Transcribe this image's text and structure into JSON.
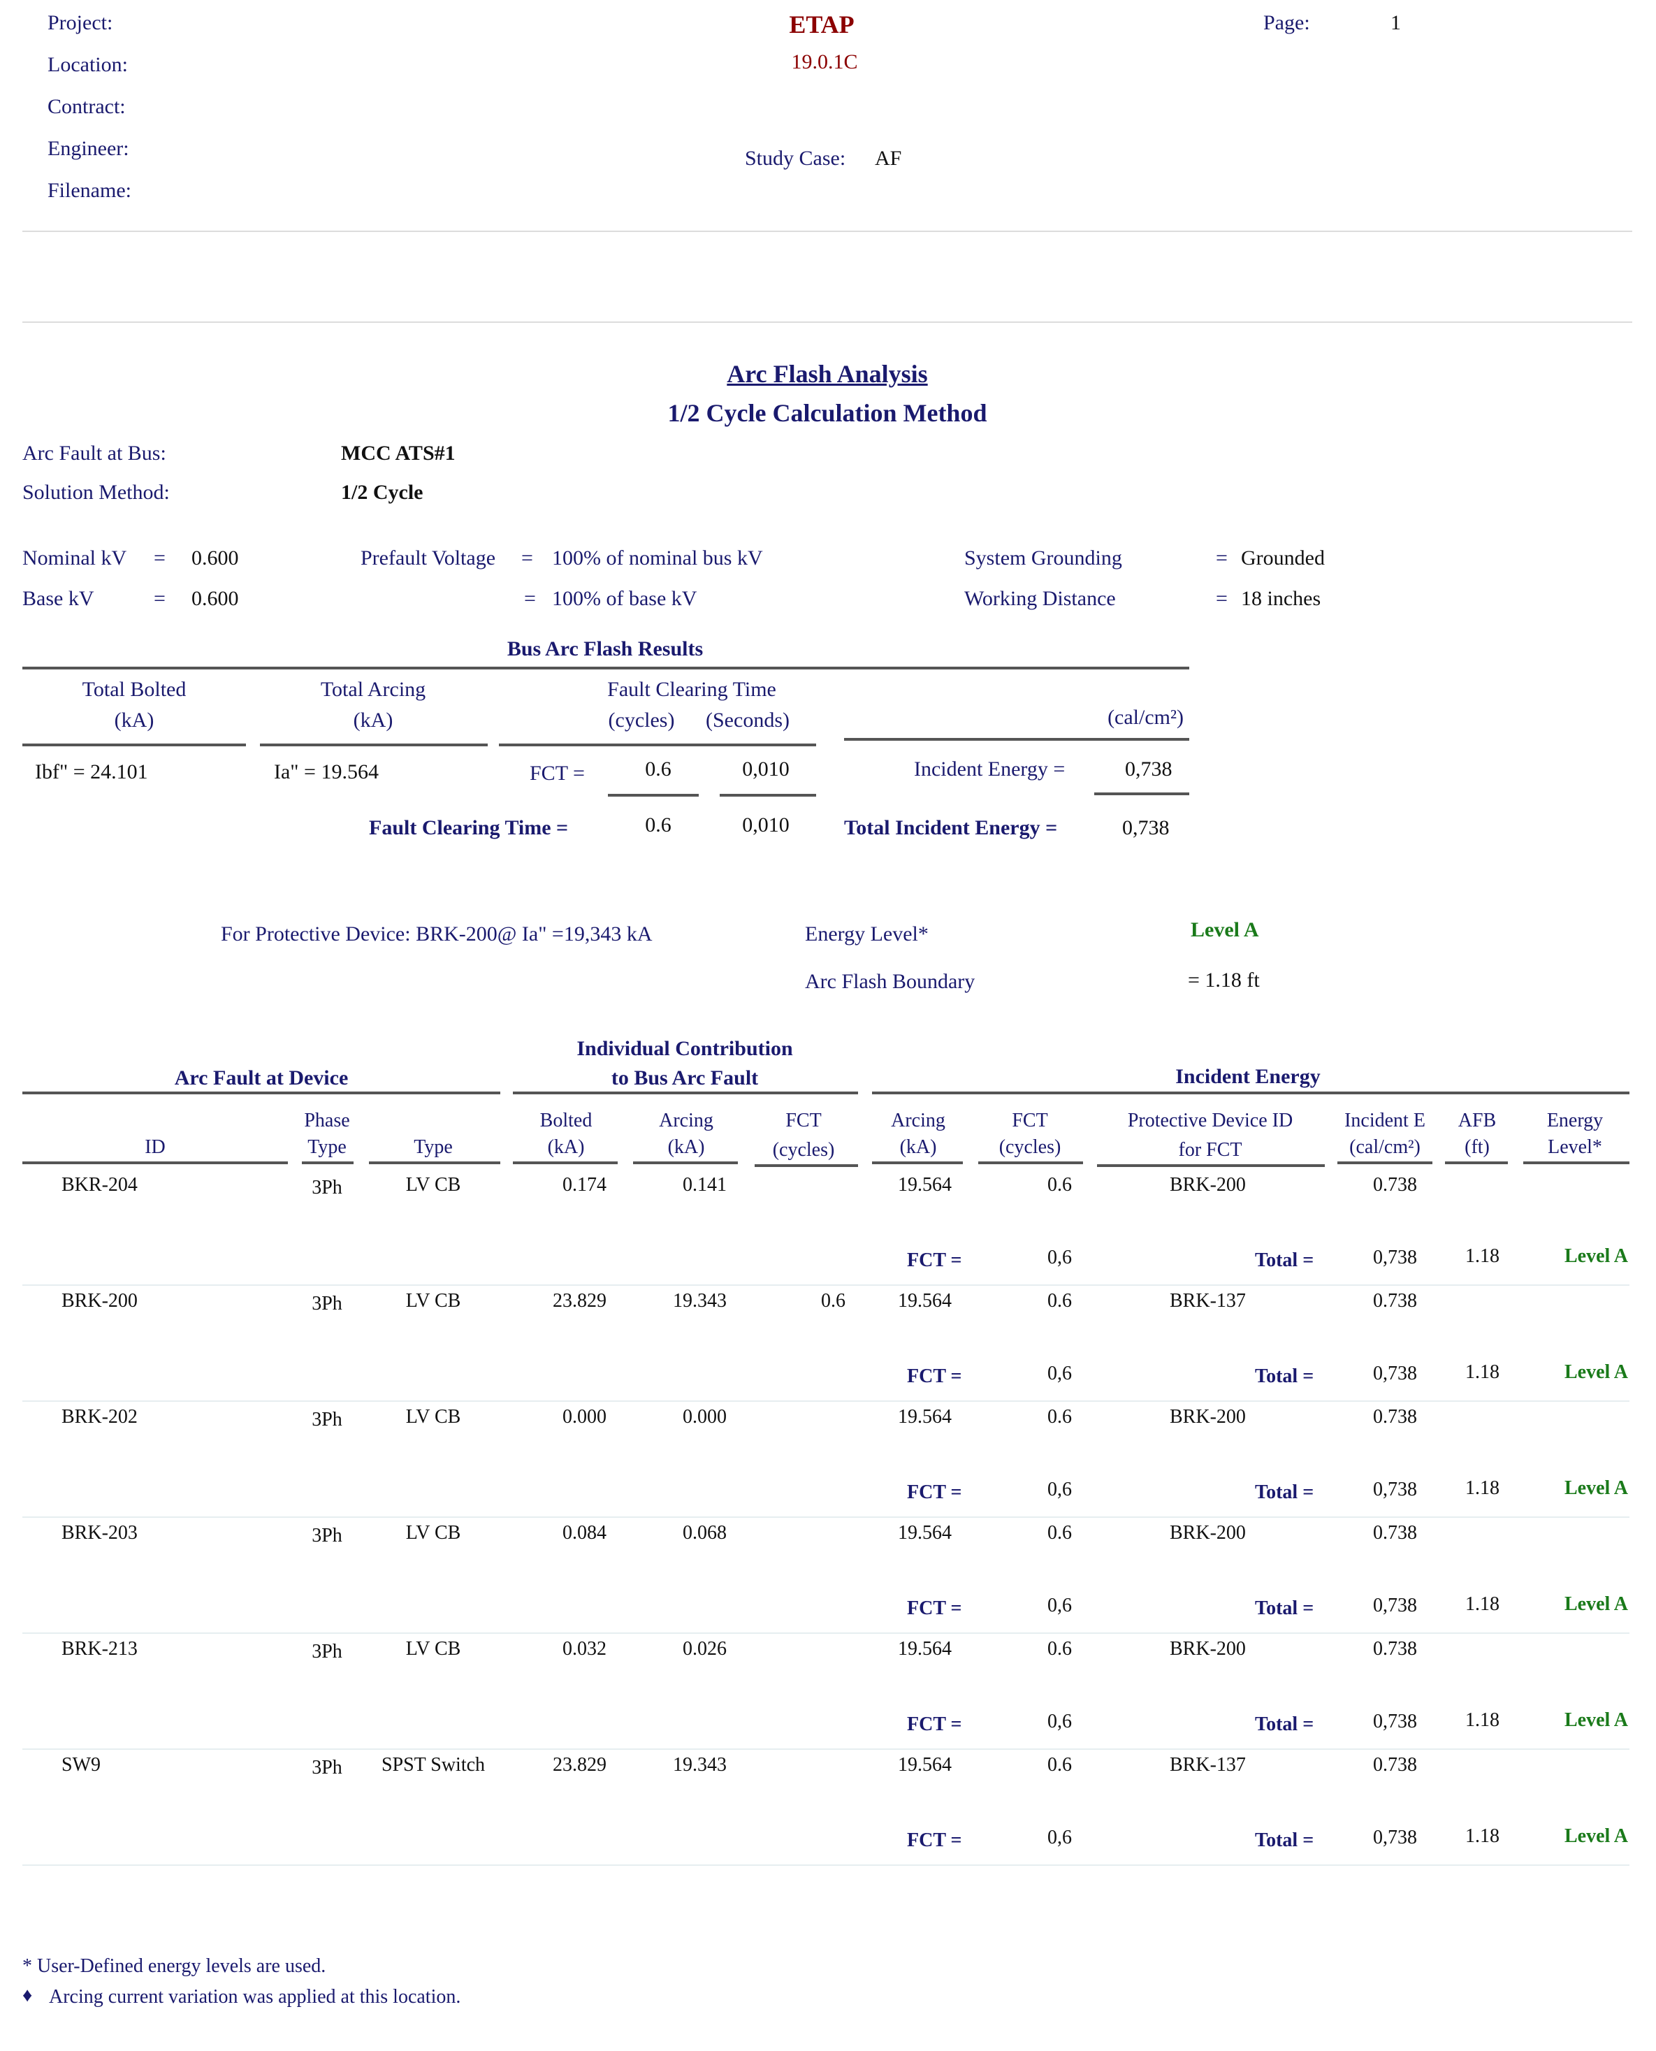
{
  "header": {
    "project_label": "Project:",
    "location_label": "Location:",
    "contract_label": "Contract:",
    "engineer_label": "Engineer:",
    "filename_label": "Filename:",
    "app_name": "ETAP",
    "version": "19.0.1C",
    "page_label": "Page:",
    "page_number": "1",
    "study_case_label": "Study Case:",
    "study_case_value": "AF"
  },
  "title": {
    "main": "Arc Flash Analysis",
    "sub": "1/2 Cycle Calculation Method"
  },
  "info": {
    "arc_fault_bus_label": "Arc Fault at Bus:",
    "arc_fault_bus_value": "MCC ATS#1",
    "solution_method_label": "Solution Method:",
    "solution_method_value": "1/2 Cycle",
    "nominal_kv_label": "Nominal kV",
    "nominal_kv_value": "0.600",
    "base_kv_label": "Base kV",
    "base_kv_value": "0.600",
    "eq": "=",
    "prefault_label": "Prefault Voltage",
    "prefault_value1": "100% of nominal bus kV",
    "prefault_value2": "100% of base kV",
    "grounding_label": "System Grounding",
    "grounding_value": "Grounded",
    "working_distance_label": "Working Distance",
    "working_distance_value": "18 inches"
  },
  "bus_results": {
    "section_title": "Bus Arc Flash Results",
    "col_bolted_1": "Total Bolted",
    "col_bolted_2": "(kA)",
    "col_arcing_1": "Total Arcing",
    "col_arcing_2": "(kA)",
    "col_fct_1": "Fault Clearing Time",
    "col_fct_cycles": "(cycles)",
    "col_fct_seconds": "(Seconds)",
    "col_energy_unit": "(cal/cm²)",
    "ibf": "Ibf\" = 24.101",
    "ia": "Ia\" = 19.564",
    "fct_label": "FCT =",
    "fct_cycles": "0.6",
    "fct_seconds": "0,010",
    "incident_label": "Incident Energy =",
    "incident_value": "0,738",
    "total_fct_label": "Fault Clearing Time =",
    "total_fct_cycles": "0.6",
    "total_fct_seconds": "0,010",
    "total_incident_label": "Total Incident Energy =",
    "total_incident_value": "0,738"
  },
  "protective": {
    "device_text": "For Protective Device: BRK-200@ Ia\" =19,343 kA",
    "energy_level_label": "Energy Level*",
    "energy_level_value": "Level A",
    "afb_label": "Arc Flash Boundary",
    "afb_value": "= 1.18 ft"
  },
  "device_table": {
    "group_arc_fault": "Arc Fault at Device",
    "group_individual_1": "Individual Contribution",
    "group_individual_2": "to Bus Arc Fault",
    "group_incident": "Incident Energy",
    "h_id": "ID",
    "h_phase_1": "Phase",
    "h_phase_2": "Type",
    "h_type": "Type",
    "h_bolted_1": "Bolted",
    "h_bolted_2": "(kA)",
    "h_arcing_1": "Arcing",
    "h_arcing_2": "(kA)",
    "h_fct_1": "FCT",
    "h_fct_2": "(cycles)",
    "h_iarc_1": "Arcing",
    "h_iarc_2": "(kA)",
    "h_ifct_1": "FCT",
    "h_ifct_2": "(cycles)",
    "h_pd_1": "Protective Device ID",
    "h_pd_2": "for FCT",
    "h_ie_1": "Incident E",
    "h_ie_2": "(cal/cm²)",
    "h_afb_1": "AFB",
    "h_afb_2": "(ft)",
    "h_level_1": "Energy",
    "h_level_2": "Level*",
    "fct_label": "FCT =",
    "total_label": "Total  =",
    "rows": [
      {
        "id": "BKR-204",
        "phase": "3Ph",
        "type": "LV CB",
        "bolted": "0.174",
        "arcing": "0.141",
        "fct": "",
        "iarc": "19.564",
        "ifct": "0.6",
        "pd": "BRK-200",
        "ie": "0.738",
        "sum_fct": "0,6",
        "sum_ie": "0,738",
        "afb": "1.18",
        "level": "Level A"
      },
      {
        "id": "BRK-200",
        "phase": "3Ph",
        "type": "LV CB",
        "bolted": "23.829",
        "arcing": "19.343",
        "fct": "0.6",
        "iarc": "19.564",
        "ifct": "0.6",
        "pd": "BRK-137",
        "ie": "0.738",
        "sum_fct": "0,6",
        "sum_ie": "0,738",
        "afb": "1.18",
        "level": "Level A"
      },
      {
        "id": "BRK-202",
        "phase": "3Ph",
        "type": "LV CB",
        "bolted": "0.000",
        "arcing": "0.000",
        "fct": "",
        "iarc": "19.564",
        "ifct": "0.6",
        "pd": "BRK-200",
        "ie": "0.738",
        "sum_fct": "0,6",
        "sum_ie": "0,738",
        "afb": "1.18",
        "level": "Level A"
      },
      {
        "id": "BRK-203",
        "phase": "3Ph",
        "type": "LV CB",
        "bolted": "0.084",
        "arcing": "0.068",
        "fct": "",
        "iarc": "19.564",
        "ifct": "0.6",
        "pd": "BRK-200",
        "ie": "0.738",
        "sum_fct": "0,6",
        "sum_ie": "0,738",
        "afb": "1.18",
        "level": "Level A"
      },
      {
        "id": "BRK-213",
        "phase": "3Ph",
        "type": "LV CB",
        "bolted": "0.032",
        "arcing": "0.026",
        "fct": "",
        "iarc": "19.564",
        "ifct": "0.6",
        "pd": "BRK-200",
        "ie": "0.738",
        "sum_fct": "0,6",
        "sum_ie": "0,738",
        "afb": "1.18",
        "level": "Level A"
      },
      {
        "id": "SW9",
        "phase": "3Ph",
        "type": "SPST Switch",
        "bolted": "23.829",
        "arcing": "19.343",
        "fct": "",
        "iarc": "19.564",
        "ifct": "0.6",
        "pd": "BRK-137",
        "ie": "0.738",
        "sum_fct": "0,6",
        "sum_ie": "0,738",
        "afb": "1.18",
        "level": "Level A"
      }
    ]
  },
  "footnotes": {
    "note1": "* User-Defined energy levels are used.",
    "note2_symbol": "♦",
    "note2": "Arcing current variation was applied at this location."
  }
}
